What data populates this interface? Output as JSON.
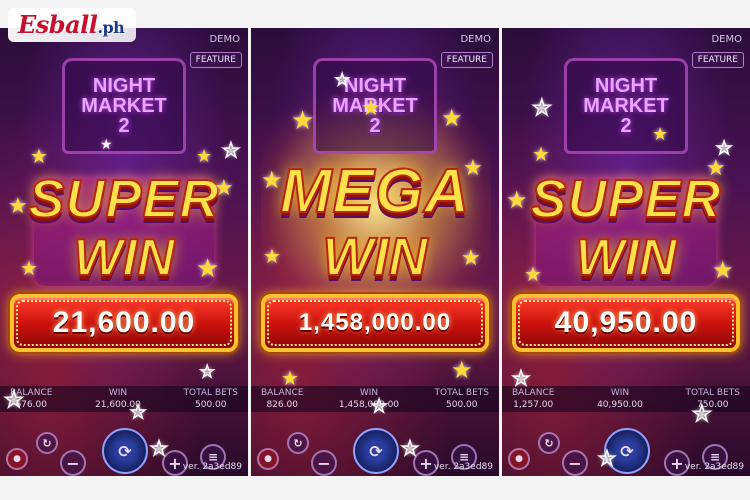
{
  "logo": {
    "brand": "Esball",
    "suffix": ".ph"
  },
  "panels": [
    {
      "demo_label": "DEMO",
      "feature_label": "FEATURE",
      "title_lines": [
        "NIGHT",
        "MARKET",
        "2"
      ],
      "win_line1": "SUPER",
      "win_line2": "WIN",
      "win_amount": "21,600.00",
      "balance_label": "BALANCE",
      "balance_value": "676.00",
      "win_label": "WIN",
      "win_value": "21,600.00",
      "bets_label": "TOTAL BETS",
      "bets_value": "500.00",
      "version": "ver. 2a3ed89"
    },
    {
      "demo_label": "DEMO",
      "feature_label": "FEATURE",
      "title_lines": [
        "NIGHT",
        "MARKET",
        "2"
      ],
      "win_line1": "MEGA",
      "win_line2": "WIN",
      "win_amount": "1,458,000.00",
      "balance_label": "BALANCE",
      "balance_value": "826.00",
      "win_label": "WIN",
      "win_value": "1,458,000.00",
      "bets_label": "TOTAL BETS",
      "bets_value": "500.00",
      "version": "ver. 2a3ed89"
    },
    {
      "demo_label": "DEMO",
      "feature_label": "FEATURE",
      "title_lines": [
        "NIGHT",
        "MARKET",
        "2"
      ],
      "win_line1": "SUPER",
      "win_line2": "WIN",
      "win_amount": "40,950.00",
      "balance_label": "BALANCE",
      "balance_value": "1,257.00",
      "win_label": "WIN",
      "win_value": "40,950.00",
      "bets_label": "TOTAL BETS",
      "bets_value": "750.00",
      "version": "ver. 2a3ed89"
    }
  ],
  "controls": {
    "minus_icon": "minus-icon",
    "plus_icon": "plus-icon",
    "spin_icon": "spin-icon",
    "menu_icon": "menu-icon",
    "auto_icon": "autoplay-icon",
    "record_icon": "record-icon"
  },
  "colors": {
    "win_text": "#ffe24a",
    "amount_bg": "#c8100c",
    "amount_border": "#ffc22e"
  }
}
